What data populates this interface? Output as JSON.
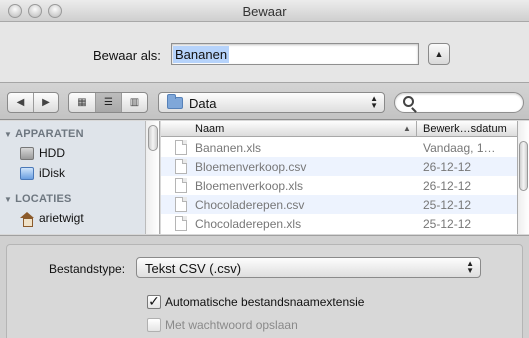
{
  "window": {
    "title": "Bewaar"
  },
  "save_as": {
    "label": "Bewaar als:",
    "value": "Bananen"
  },
  "toolbar": {
    "location": "Data",
    "search_placeholder": ""
  },
  "sidebar": {
    "sections": [
      {
        "title": "APPARATEN",
        "items": [
          {
            "label": "HDD",
            "icon": "hdd-icon"
          },
          {
            "label": "iDisk",
            "icon": "idisk-icon"
          }
        ]
      },
      {
        "title": "LOCATIES",
        "items": [
          {
            "label": "arietwigt",
            "icon": "home-icon"
          }
        ]
      }
    ]
  },
  "file_list": {
    "columns": {
      "name": "Naam",
      "date": "Bewerk…sdatum"
    },
    "rows": [
      {
        "name": "Bananen.xls",
        "date": "Vandaag, 1…"
      },
      {
        "name": "Bloemenverkoop.csv",
        "date": "26-12-12"
      },
      {
        "name": "Bloemenverkoop.xls",
        "date": "26-12-12"
      },
      {
        "name": "Chocoladerepen.csv",
        "date": "25-12-12"
      },
      {
        "name": "Chocoladerepen.xls",
        "date": "25-12-12"
      }
    ]
  },
  "options": {
    "file_type_label": "Bestandstype:",
    "file_type_value": "Tekst CSV (.csv)",
    "auto_extension_label": "Automatische bestandsnaamextensie",
    "auto_extension_checked": true,
    "password_label": "Met wachtwoord opslaan",
    "password_checked": false
  }
}
